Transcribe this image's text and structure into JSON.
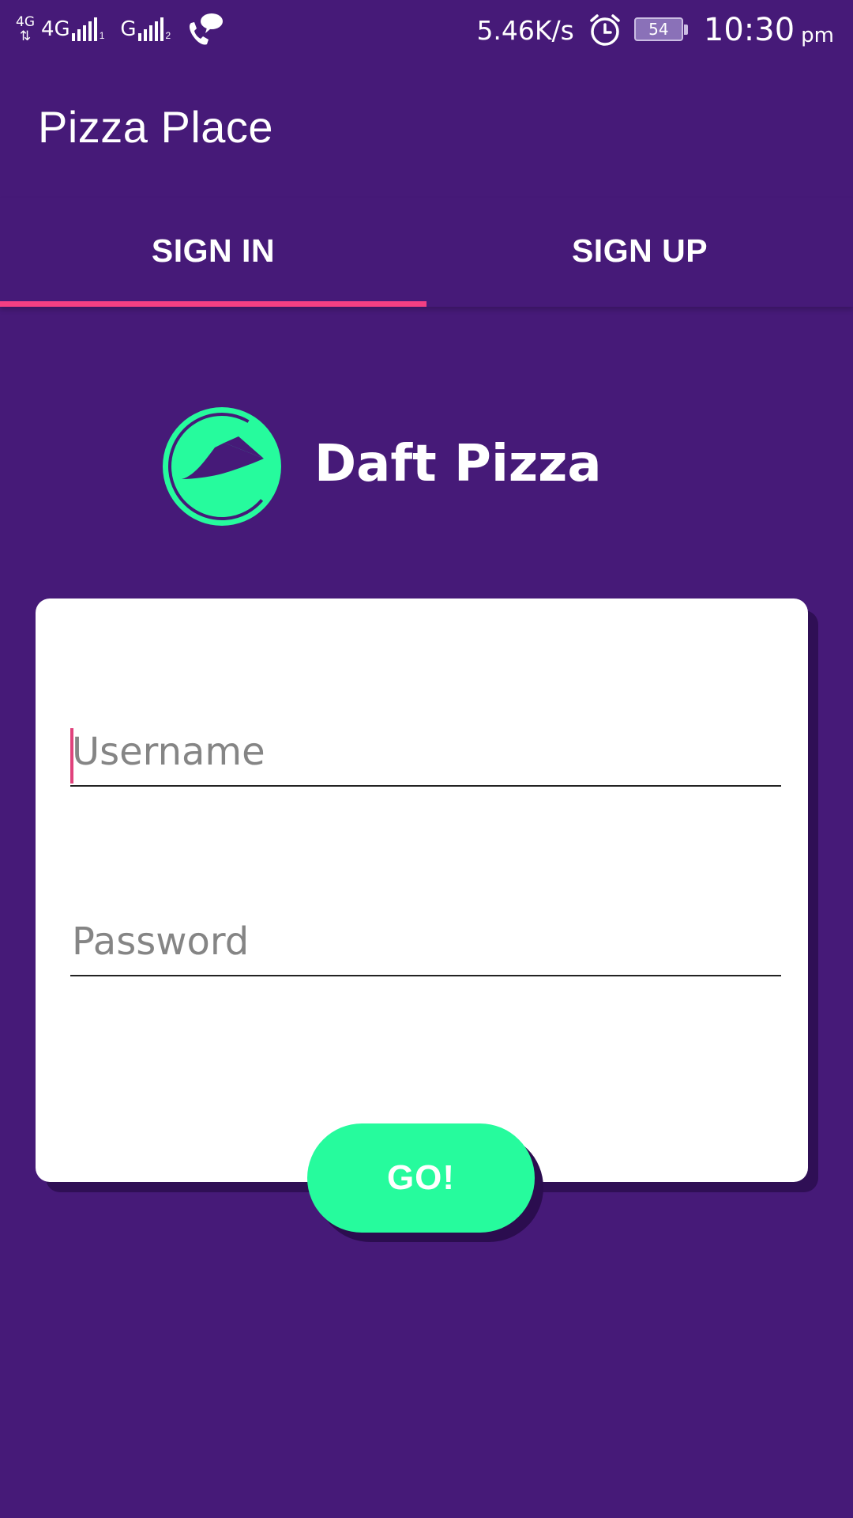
{
  "status_bar": {
    "network_small": "4G",
    "network_1": "4G",
    "sim_1": "1",
    "network_2": "G",
    "sim_2": "2",
    "speed": "5.46K/s",
    "battery": "54",
    "time": "10:30",
    "ampm": "pm"
  },
  "app_bar": {
    "title": "Pizza Place"
  },
  "tabs": [
    {
      "label": "SIGN IN",
      "selected": true
    },
    {
      "label": "SIGN UP",
      "selected": false
    }
  ],
  "logo": {
    "text": "Daft Pizza",
    "icon": "pizza-slice-logo-icon"
  },
  "form": {
    "username_placeholder": "Username",
    "username_value": "",
    "password_placeholder": "Password",
    "password_value": ""
  },
  "go_button": {
    "label": "GO!"
  },
  "colors": {
    "background": "#461a78",
    "tab_indicator": "#f33f83",
    "accent_green": "#26fb9d",
    "card": "#ffffff",
    "caret": "#e0427c"
  }
}
